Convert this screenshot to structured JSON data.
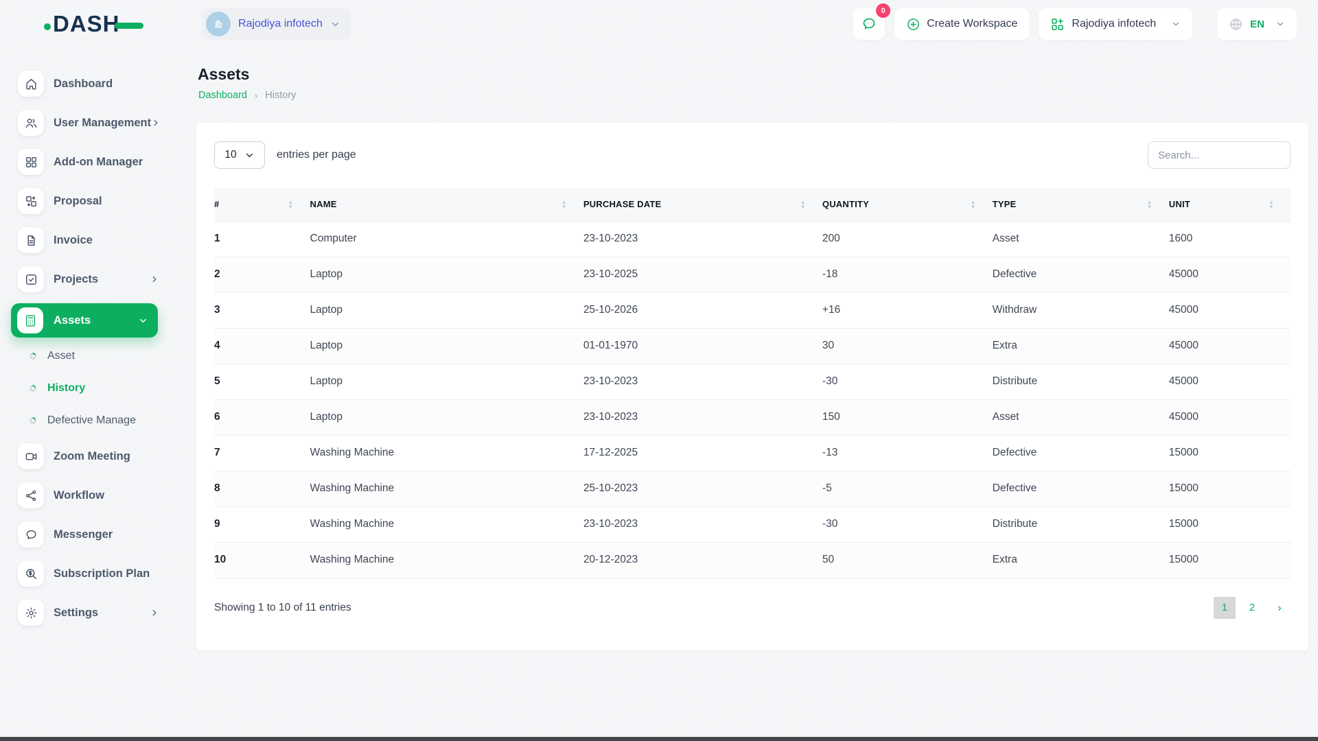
{
  "colors": {
    "accent_green": "#0caf60",
    "badge_pink": "#f5426f",
    "workspace_link_blue": "#4553d6",
    "logo_navy": "#16324f"
  },
  "header": {
    "logo_text": "DASH",
    "workspace_selector": {
      "icon": "building-icon",
      "label": "Rajodiya infotech"
    },
    "messages_button": {
      "icon": "chat-bubble-icon",
      "badge": "0"
    },
    "create_workspace": {
      "icon": "plus-circle-icon",
      "label": "Create Workspace"
    },
    "workspace_menu": {
      "icon": "grid-plus-icon",
      "label": "Rajodiya infotech"
    },
    "language_menu": {
      "icon": "globe-icon",
      "label": "EN"
    }
  },
  "sidebar": {
    "items": [
      {
        "label": "Dashboard",
        "icon": "home-icon"
      },
      {
        "label": "User Management",
        "icon": "users-icon",
        "chevron": "right"
      },
      {
        "label": "Add-on Manager",
        "icon": "grid-icon"
      },
      {
        "label": "Proposal",
        "icon": "swap-boxes-icon"
      },
      {
        "label": "Invoice",
        "icon": "invoice-icon"
      },
      {
        "label": "Projects",
        "icon": "check-square-icon",
        "chevron": "right"
      },
      {
        "label": "Assets",
        "icon": "calculator-icon",
        "active": true,
        "chevron": "down",
        "submenu": [
          {
            "label": "Asset",
            "icon": "circle-dot-icon"
          },
          {
            "label": "History",
            "icon": "circle-dot-icon",
            "active": true
          },
          {
            "label": "Defective Manage",
            "icon": "circle-dot-icon"
          }
        ]
      },
      {
        "label": "Zoom Meeting",
        "icon": "video-camera-icon"
      },
      {
        "label": "Workflow",
        "icon": "workflow-icon"
      },
      {
        "label": "Messenger",
        "icon": "messenger-icon"
      },
      {
        "label": "Subscription Plan",
        "icon": "search-dollar-icon"
      },
      {
        "label": "Settings",
        "icon": "gear-icon",
        "chevron": "right"
      }
    ]
  },
  "page": {
    "title": "Assets",
    "breadcrumb": {
      "home": "Dashboard",
      "separator": "›",
      "current": "History"
    }
  },
  "controls": {
    "entries_value": "10",
    "entries_label": "entries per page",
    "search_placeholder": "Search..."
  },
  "table": {
    "columns": [
      "#",
      "NAME",
      "PURCHASE DATE",
      "QUANTITY",
      "TYPE",
      "UNIT"
    ],
    "rows": [
      [
        "1",
        "Computer",
        "23-10-2023",
        "200",
        "Asset",
        "1600"
      ],
      [
        "2",
        "Laptop",
        "23-10-2025",
        "-18",
        "Defective",
        "45000"
      ],
      [
        "3",
        "Laptop",
        "25-10-2026",
        "+16",
        "Withdraw",
        "45000"
      ],
      [
        "4",
        "Laptop",
        "01-01-1970",
        "30",
        "Extra",
        "45000"
      ],
      [
        "5",
        "Laptop",
        "23-10-2023",
        "-30",
        "Distribute",
        "45000"
      ],
      [
        "6",
        "Laptop",
        "23-10-2023",
        "150",
        "Asset",
        "45000"
      ],
      [
        "7",
        "Washing Machine",
        "17-12-2025",
        "-13",
        "Defective",
        "15000"
      ],
      [
        "8",
        "Washing Machine",
        "25-10-2023",
        "-5",
        "Defective",
        "15000"
      ],
      [
        "9",
        "Washing Machine",
        "23-10-2023",
        "-30",
        "Distribute",
        "15000"
      ],
      [
        "10",
        "Washing Machine",
        "20-12-2023",
        "50",
        "Extra",
        "15000"
      ]
    ]
  },
  "footer": {
    "summary": "Showing 1 to 10 of 11 entries",
    "pages": [
      "1",
      "2"
    ],
    "current_page": "1",
    "next": "›"
  }
}
